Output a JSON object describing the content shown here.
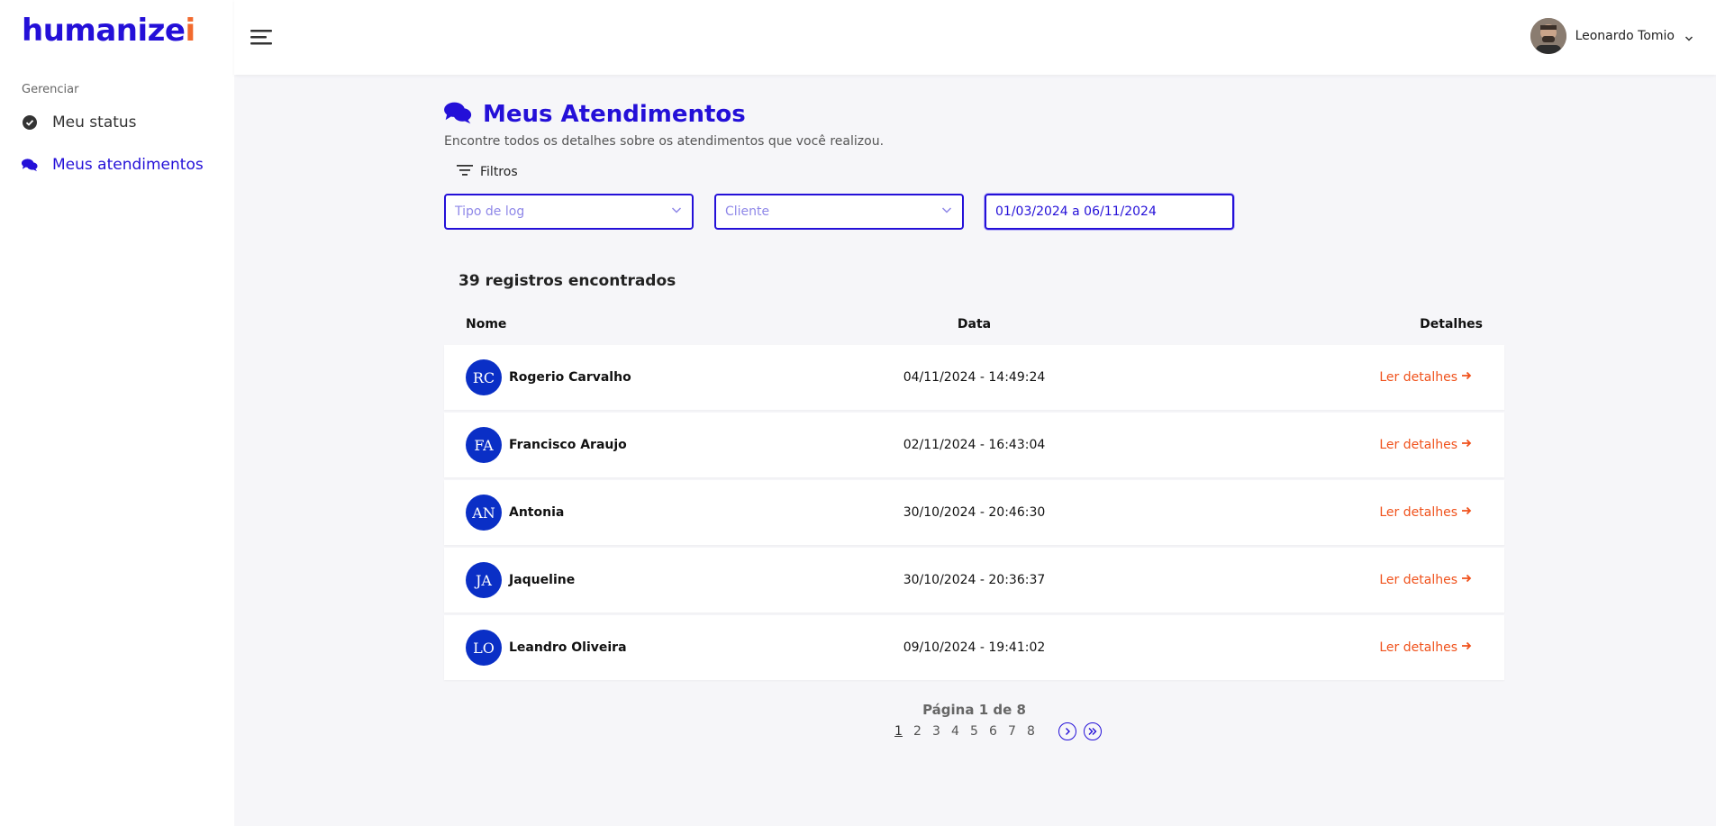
{
  "brand": {
    "logo_main": "humanize",
    "logo_accent": "i"
  },
  "sidebar": {
    "section": "Gerenciar",
    "items": [
      {
        "label": "Meu status",
        "icon": "check-circle-icon"
      },
      {
        "label": "Meus atendimentos",
        "icon": "chat-bubbles-icon"
      }
    ]
  },
  "header": {
    "user_name": "Leonardo Tomio"
  },
  "page": {
    "title": "Meus Atendimentos",
    "subtitle": "Encontre todos os detalhes sobre os atendimentos que você realizou.",
    "filters_label": "Filtros"
  },
  "filters": {
    "log_type_placeholder": "Tipo de log",
    "client_placeholder": "Cliente",
    "date_range": "01/03/2024 a 06/11/2024"
  },
  "results": {
    "count_text": "39 registros encontrados",
    "columns": {
      "name": "Nome",
      "date": "Data",
      "details": "Detalhes"
    },
    "details_link": "Ler detalhes",
    "rows": [
      {
        "initials": "RC",
        "name": "Rogerio Carvalho",
        "date": "04/11/2024 - 14:49:24"
      },
      {
        "initials": "FA",
        "name": "Francisco Araujo",
        "date": "02/11/2024 - 16:43:04"
      },
      {
        "initials": "AN",
        "name": "Antonia",
        "date": "30/10/2024 - 20:46:30"
      },
      {
        "initials": "JA",
        "name": "Jaqueline",
        "date": "30/10/2024 - 20:36:37"
      },
      {
        "initials": "LO",
        "name": "Leandro Oliveira",
        "date": "09/10/2024 - 19:41:02"
      }
    ]
  },
  "pagination": {
    "label": "Página 1 de 8",
    "pages": [
      "1",
      "2",
      "3",
      "4",
      "5",
      "6",
      "7",
      "8"
    ],
    "current": "1"
  },
  "colors": {
    "primary": "#2410d8",
    "accent": "#f26a2e",
    "link": "#f0521c",
    "avatar_bg": "#0a2fc6"
  }
}
